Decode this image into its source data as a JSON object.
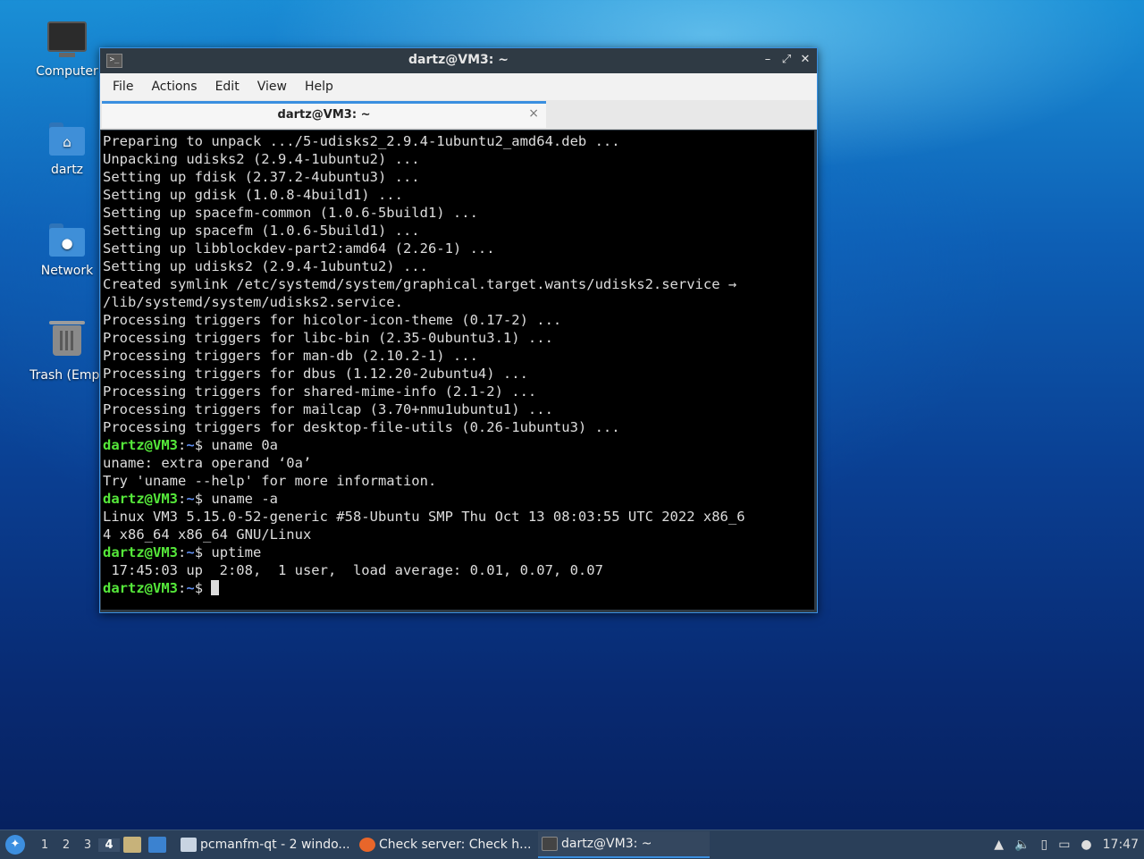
{
  "desktop": {
    "icons": [
      {
        "label": "Computer",
        "icon": "monitor-icon"
      },
      {
        "label": "dartz",
        "icon": "home-folder-icon"
      },
      {
        "label": "Network",
        "icon": "network-folder-icon"
      },
      {
        "label": "Trash (Empt",
        "icon": "trash-icon"
      }
    ]
  },
  "window": {
    "title": "dartz@VM3: ~",
    "menu": [
      "File",
      "Actions",
      "Edit",
      "View",
      "Help"
    ],
    "tab_label": "dartz@VM3: ~",
    "tab_close": "×",
    "controls": {
      "minimize": "–",
      "maximize": "⤢",
      "close": "✕"
    }
  },
  "terminal": {
    "prompt_user": "dartz@VM3",
    "prompt_sep": ":",
    "prompt_dir": "~",
    "prompt_end": "$ ",
    "lines": [
      {
        "type": "out",
        "text": "Preparing to unpack .../5-udisks2_2.9.4-1ubuntu2_amd64.deb ..."
      },
      {
        "type": "out",
        "text": "Unpacking udisks2 (2.9.4-1ubuntu2) ..."
      },
      {
        "type": "out",
        "text": "Setting up fdisk (2.37.2-4ubuntu3) ..."
      },
      {
        "type": "out",
        "text": "Setting up gdisk (1.0.8-4build1) ..."
      },
      {
        "type": "out",
        "text": "Setting up spacefm-common (1.0.6-5build1) ..."
      },
      {
        "type": "out",
        "text": "Setting up spacefm (1.0.6-5build1) ..."
      },
      {
        "type": "out",
        "text": "Setting up libblockdev-part2:amd64 (2.26-1) ..."
      },
      {
        "type": "out",
        "text": "Setting up udisks2 (2.9.4-1ubuntu2) ..."
      },
      {
        "type": "out",
        "text": "Created symlink /etc/systemd/system/graphical.target.wants/udisks2.service →"
      },
      {
        "type": "out",
        "text": "/lib/systemd/system/udisks2.service."
      },
      {
        "type": "out",
        "text": "Processing triggers for hicolor-icon-theme (0.17-2) ..."
      },
      {
        "type": "out",
        "text": "Processing triggers for libc-bin (2.35-0ubuntu3.1) ..."
      },
      {
        "type": "out",
        "text": "Processing triggers for man-db (2.10.2-1) ..."
      },
      {
        "type": "out",
        "text": "Processing triggers for dbus (1.12.20-2ubuntu4) ..."
      },
      {
        "type": "out",
        "text": "Processing triggers for shared-mime-info (2.1-2) ..."
      },
      {
        "type": "out",
        "text": "Processing triggers for mailcap (3.70+nmu1ubuntu1) ..."
      },
      {
        "type": "out",
        "text": "Processing triggers for desktop-file-utils (0.26-1ubuntu3) ..."
      },
      {
        "type": "cmd",
        "text": "uname 0a"
      },
      {
        "type": "out",
        "text": "uname: extra operand ‘0a’"
      },
      {
        "type": "out",
        "text": "Try 'uname --help' for more information."
      },
      {
        "type": "cmd",
        "text": "uname -a"
      },
      {
        "type": "out",
        "text": "Linux VM3 5.15.0-52-generic #58-Ubuntu SMP Thu Oct 13 08:03:55 UTC 2022 x86_6"
      },
      {
        "type": "out",
        "text": "4 x86_64 x86_64 GNU/Linux"
      },
      {
        "type": "cmd",
        "text": "uptime"
      },
      {
        "type": "out",
        "text": " 17:45:03 up  2:08,  1 user,  load average: 0.01, 0.07, 0.07"
      },
      {
        "type": "cursor",
        "text": ""
      }
    ]
  },
  "taskbar": {
    "workspaces": [
      "1",
      "2",
      "3",
      "4"
    ],
    "active_workspace": "4",
    "tasks": [
      {
        "label": "pcmanfm-qt - 2 windo...",
        "icon": "file-manager-icon",
        "color": "#c8d4e2"
      },
      {
        "label": "Check server: Check h...",
        "icon": "firefox-icon",
        "color": "#e8662a"
      },
      {
        "label": "dartz@VM3: ~",
        "icon": "terminal-icon",
        "color": "#444444"
      }
    ],
    "clock": "17:47"
  }
}
